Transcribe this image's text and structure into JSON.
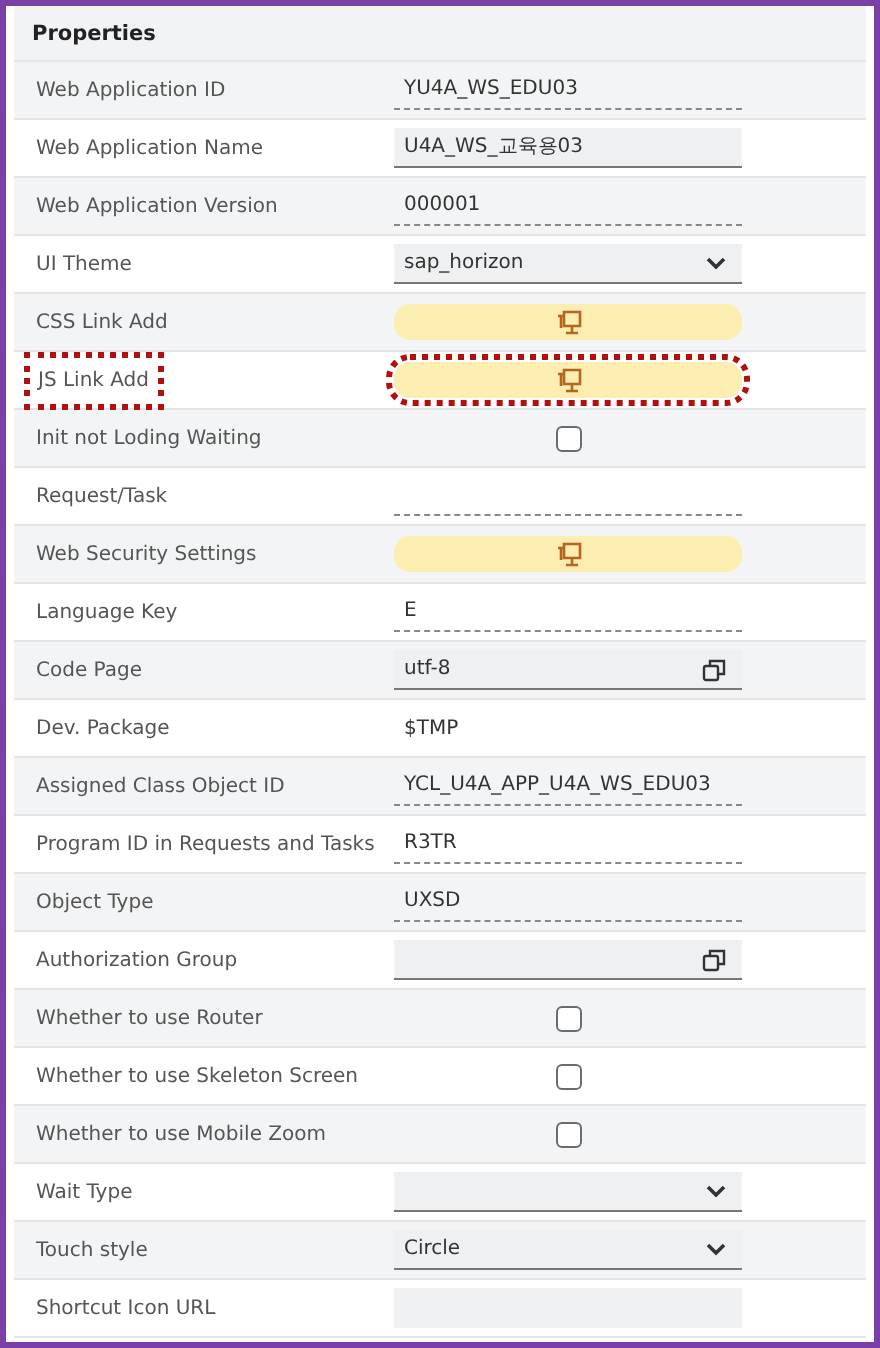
{
  "panel": {
    "title": "Properties"
  },
  "rows": [
    {
      "label": "Web Application ID",
      "kind": "display",
      "value": "YU4A_WS_EDU03",
      "highlighted": false
    },
    {
      "label": "Web Application Name",
      "kind": "input",
      "value": "U4A_WS_교육용03",
      "highlighted": false
    },
    {
      "label": "Web Application Version",
      "kind": "display",
      "value": "000001",
      "highlighted": false
    },
    {
      "label": "UI Theme",
      "kind": "select",
      "value": "sap_horizon",
      "highlighted": false
    },
    {
      "label": "CSS Link Add",
      "kind": "button",
      "highlighted": false
    },
    {
      "label": "JS Link Add",
      "kind": "button",
      "highlighted": true
    },
    {
      "label": "Init not Loding Waiting",
      "kind": "checkbox",
      "checked": false,
      "highlighted": false
    },
    {
      "label": "Request/Task",
      "kind": "display",
      "highlighted": false
    },
    {
      "label": "Web Security Settings",
      "kind": "button",
      "highlighted": false
    },
    {
      "label": "Language Key",
      "kind": "display",
      "value": "E",
      "highlighted": false
    },
    {
      "label": "Code Page",
      "kind": "valuehelp",
      "value": "utf-8",
      "highlighted": false
    },
    {
      "label": "Dev. Package",
      "kind": "text",
      "value": "$TMP",
      "highlighted": false
    },
    {
      "label": "Assigned Class Object ID",
      "kind": "display",
      "value": "YCL_U4A_APP_U4A_WS_EDU03",
      "highlighted": false
    },
    {
      "label": "Program ID in Requests and Tasks",
      "kind": "display",
      "value": "R3TR",
      "highlighted": false
    },
    {
      "label": "Object Type",
      "kind": "display",
      "value": "UXSD",
      "highlighted": false
    },
    {
      "label": "Authorization Group",
      "kind": "valuehelp",
      "highlighted": false
    },
    {
      "label": "Whether to use Router",
      "kind": "checkbox",
      "checked": false,
      "highlighted": false
    },
    {
      "label": "Whether to use Skeleton Screen",
      "kind": "checkbox",
      "checked": false,
      "highlighted": false
    },
    {
      "label": "Whether to use Mobile Zoom",
      "kind": "checkbox",
      "checked": false,
      "highlighted": false
    },
    {
      "label": "Wait Type",
      "kind": "select",
      "highlighted": false
    },
    {
      "label": "Touch style",
      "kind": "select",
      "value": "Circle",
      "highlighted": false
    },
    {
      "label": "Shortcut Icon URL",
      "kind": "disabled",
      "highlighted": false
    }
  ]
}
